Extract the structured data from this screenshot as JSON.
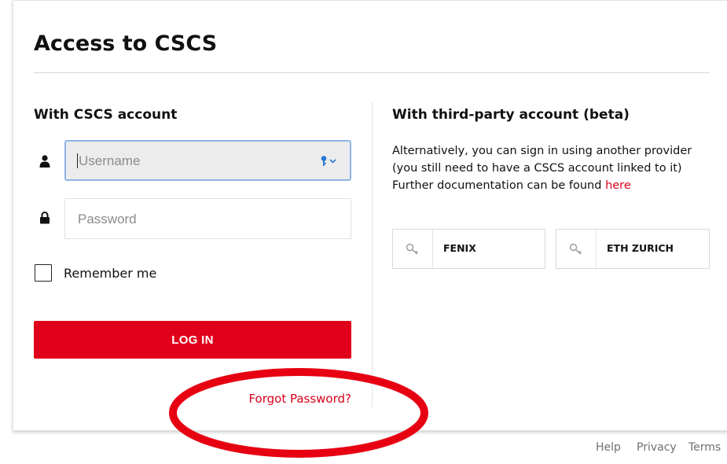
{
  "page": {
    "title": "Access to CSCS"
  },
  "cscs_login": {
    "heading": "With CSCS account",
    "username_placeholder": "Username",
    "password_placeholder": "Password",
    "remember_label": "Remember me",
    "remember_checked": false,
    "login_label": "LOG IN",
    "forgot_label": "Forgot Password?"
  },
  "third_party": {
    "heading": "With third-party account (beta)",
    "line1": "Alternatively, you can sign in using another provider",
    "line2": "(you still need to have a CSCS account linked to it)",
    "line3": "Further documentation can be found",
    "link_label": "here",
    "providers": [
      {
        "label": "FENIX",
        "icon": "key-icon"
      },
      {
        "label": "ETH ZURICH",
        "icon": "key-icon"
      }
    ]
  },
  "footer": {
    "help": "Help",
    "privacy": "Privacy",
    "terms": "Terms"
  },
  "colors": {
    "accent": "#e1001b",
    "link": "#d7001a",
    "focus_border": "#90b4e9",
    "annotation": "#e60012"
  },
  "annotation": {
    "shape": "ellipse",
    "target": "Forgot Password?"
  }
}
